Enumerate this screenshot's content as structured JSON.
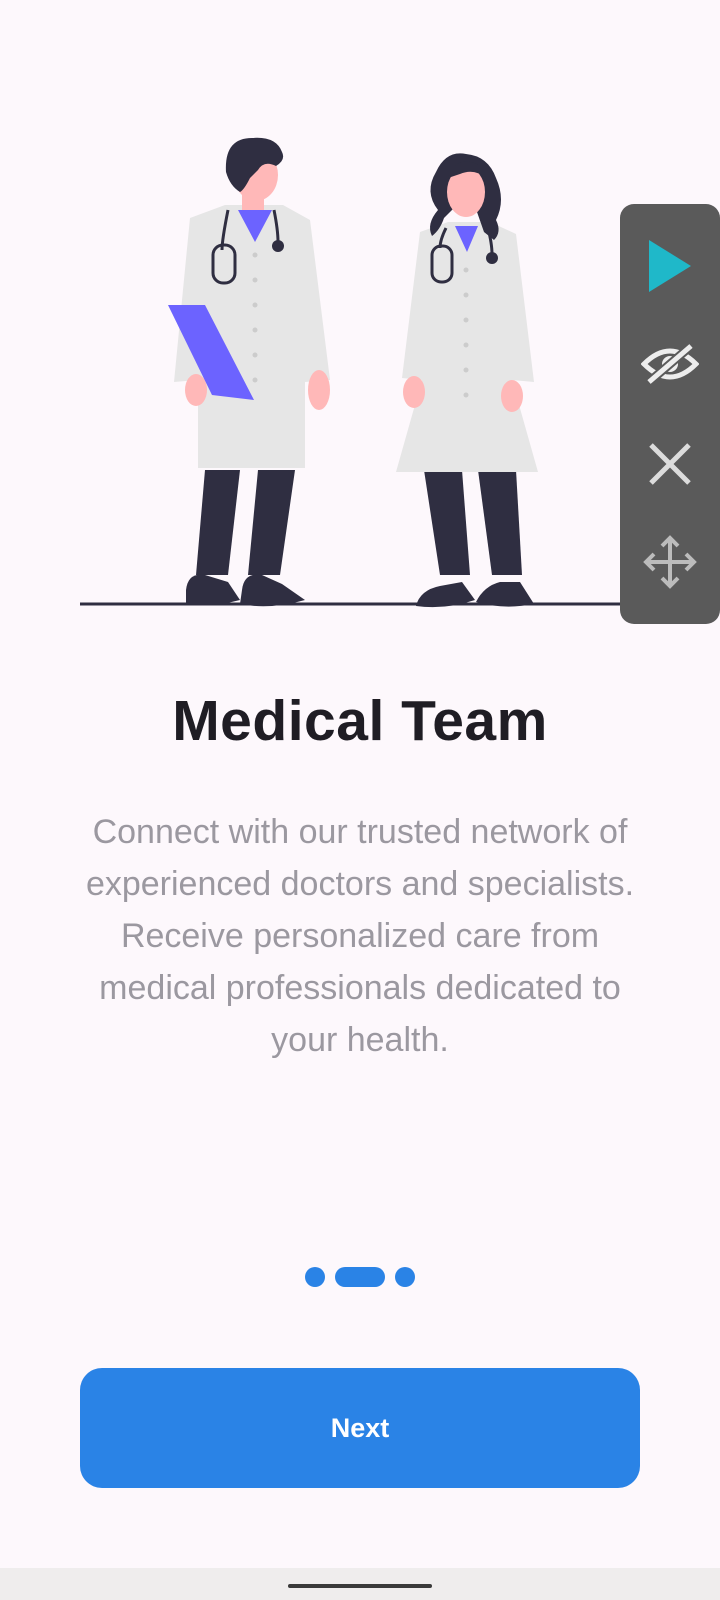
{
  "onboarding": {
    "title": "Medical Team",
    "description": "Connect with our trusted network of experienced doctors and specialists. Receive personalized care from medical professionals dedicated to your health.",
    "page_indicator": {
      "total": 3,
      "current": 2
    },
    "next_label": "Next"
  },
  "floating_toolbar": {
    "buttons": [
      "play-icon",
      "eye-off-icon",
      "close-icon",
      "move-icon"
    ]
  },
  "colors": {
    "accent": "#2a83e6",
    "background": "#fdf8fc",
    "title": "#1f1d24",
    "body_text": "#9b98a0",
    "play": "#1fb8c9",
    "clipboard": "#6c63ff",
    "scrubs": "#2f2e41"
  }
}
